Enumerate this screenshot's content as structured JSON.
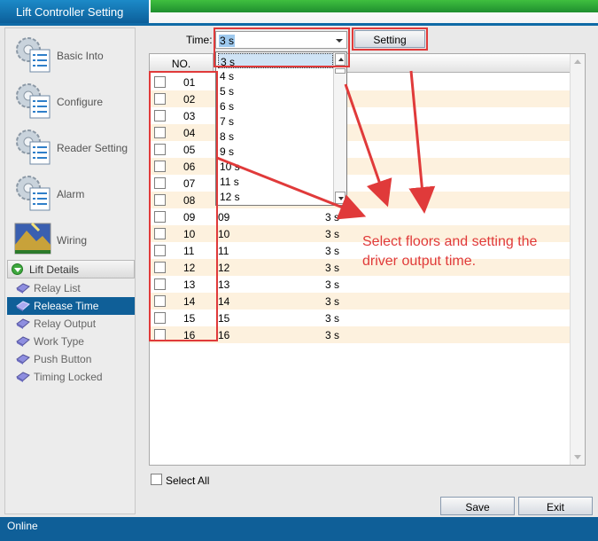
{
  "app": {
    "title": "Lift Controller Setting"
  },
  "nav": {
    "items": [
      {
        "label": "Basic Into",
        "icon": "gear-list-icon"
      },
      {
        "label": "Configure",
        "icon": "gear-list-icon"
      },
      {
        "label": "Reader Setting",
        "icon": "gear-list-icon"
      },
      {
        "label": "Alarm",
        "icon": "gear-list-icon"
      },
      {
        "label": "Wiring",
        "icon": "landscape-icon"
      }
    ],
    "section": {
      "label": "Lift Details",
      "icon": "expand-down-icon"
    },
    "sub_items": [
      {
        "label": "Relay List",
        "selected": false
      },
      {
        "label": "Release Time",
        "selected": true
      },
      {
        "label": "Relay Output",
        "selected": false
      },
      {
        "label": "Work Type",
        "selected": false
      },
      {
        "label": "Push Button",
        "selected": false
      },
      {
        "label": "Timing Locked",
        "selected": false
      }
    ]
  },
  "toolbar": {
    "time_label": "Time:",
    "time_value": "3 s",
    "setting_label": "Setting"
  },
  "dropdown": {
    "options": [
      "3 s",
      "4 s",
      "5 s",
      "6 s",
      "7 s",
      "8 s",
      "9 s",
      "10 s",
      "11 s",
      "12 s"
    ],
    "highlighted": "3 s"
  },
  "grid": {
    "header_no": "NO.",
    "rows": [
      {
        "no": "01",
        "floor": "",
        "time": ""
      },
      {
        "no": "02",
        "floor": "",
        "time": ""
      },
      {
        "no": "03",
        "floor": "",
        "time": ""
      },
      {
        "no": "04",
        "floor": "",
        "time": ""
      },
      {
        "no": "05",
        "floor": "",
        "time": ""
      },
      {
        "no": "06",
        "floor": "",
        "time": ""
      },
      {
        "no": "07",
        "floor": "",
        "time": ""
      },
      {
        "no": "08",
        "floor": "",
        "time": ""
      },
      {
        "no": "09",
        "floor": "09",
        "time": "3 s"
      },
      {
        "no": "10",
        "floor": "10",
        "time": "3 s"
      },
      {
        "no": "11",
        "floor": "11",
        "time": "3 s"
      },
      {
        "no": "12",
        "floor": "12",
        "time": "3 s"
      },
      {
        "no": "13",
        "floor": "13",
        "time": "3 s"
      },
      {
        "no": "14",
        "floor": "14",
        "time": "3 s"
      },
      {
        "no": "15",
        "floor": "15",
        "time": "3 s"
      },
      {
        "no": "16",
        "floor": "16",
        "time": "3 s"
      }
    ]
  },
  "footer": {
    "select_all_label": "Select All",
    "save_label": "Save",
    "exit_label": "Exit"
  },
  "status_bar": {
    "text": "Online"
  },
  "annotation": {
    "text": "Select floors and setting the driver output time.",
    "color": "#e03a3a"
  }
}
